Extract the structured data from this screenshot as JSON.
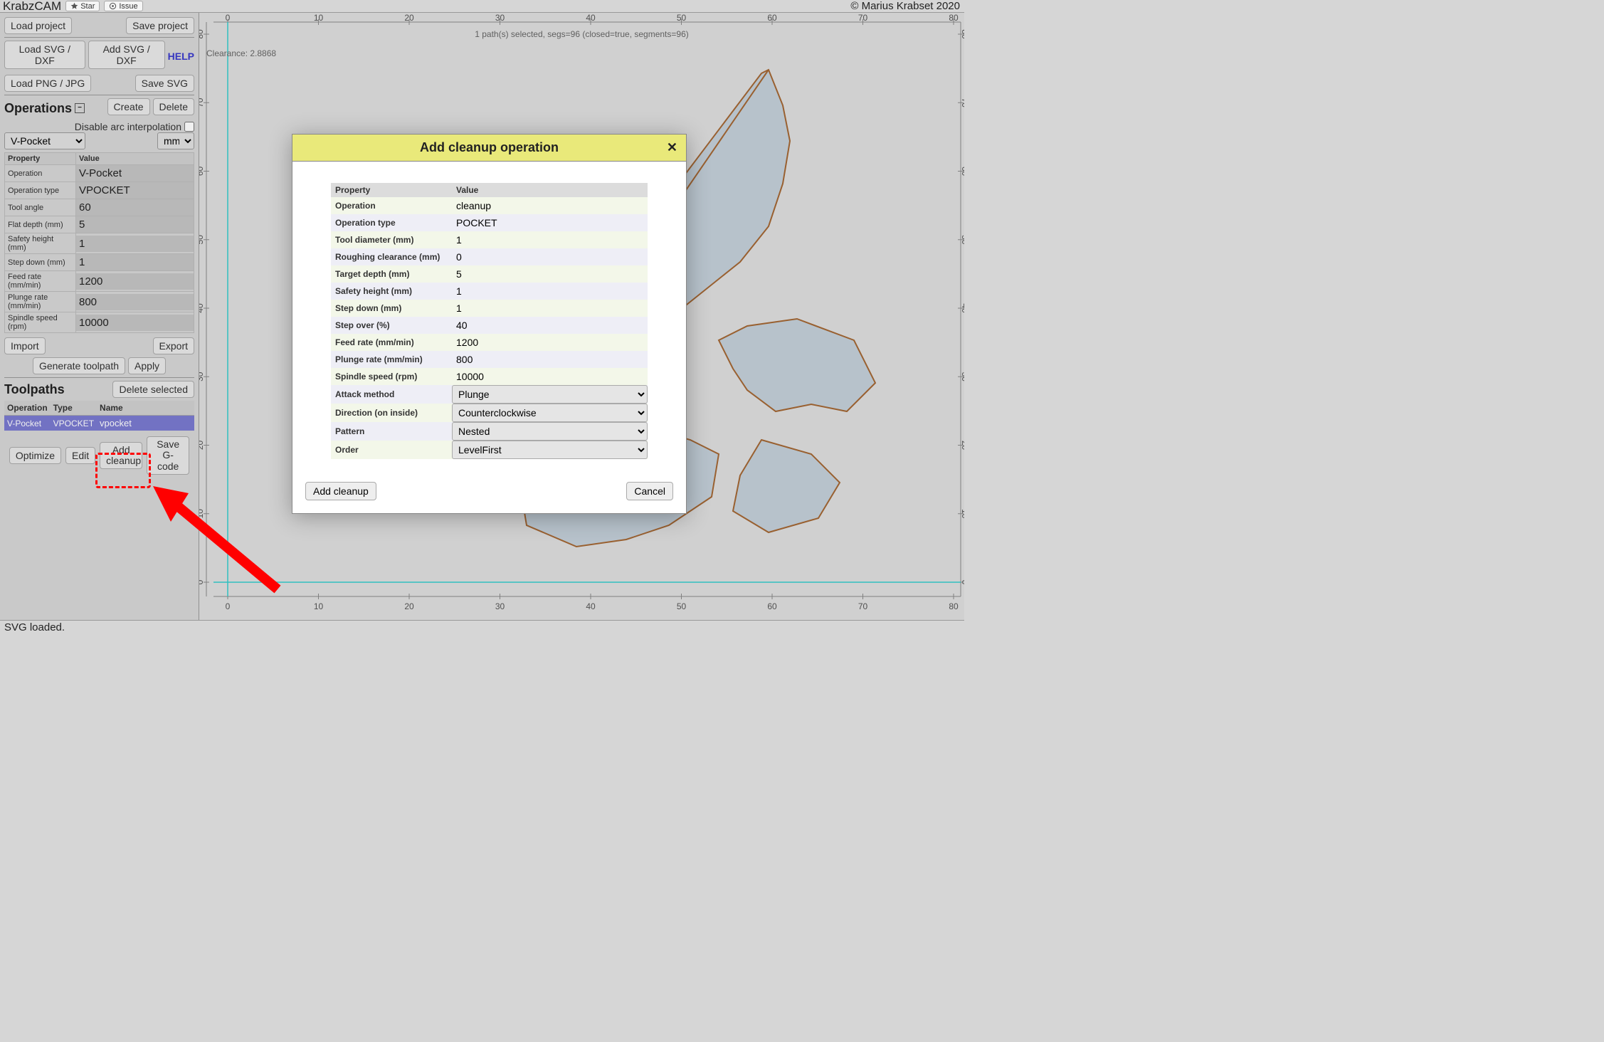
{
  "app": {
    "title": "KrabzCAM",
    "gh_star": "Star",
    "gh_issue": "Issue",
    "copyright": "© Marius Krabset 2020"
  },
  "sidebar": {
    "load_project": "Load project",
    "save_project": "Save project",
    "load_svg": "Load SVG / DXF",
    "add_svg": "Add SVG / DXF",
    "help": "HELP",
    "load_png": "Load PNG / JPG",
    "save_svg": "Save SVG",
    "operations_title": "Operations",
    "create": "Create",
    "delete": "Delete",
    "disable_arc": "Disable arc interpolation",
    "op_name_selected": "V-Pocket",
    "units_selected": "mm",
    "prop_header": "Property",
    "val_header": "Value",
    "props": [
      {
        "label": "Operation",
        "value": "V-Pocket"
      },
      {
        "label": "Operation type",
        "value": "VPOCKET"
      },
      {
        "label": "Tool angle",
        "value": "60"
      },
      {
        "label": "Flat depth (mm)",
        "value": "5"
      },
      {
        "label": "Safety height (mm)",
        "value": "1"
      },
      {
        "label": "Step down (mm)",
        "value": "1"
      },
      {
        "label": "Feed rate (mm/min)",
        "value": "1200"
      },
      {
        "label": "Plunge rate (mm/min)",
        "value": "800"
      },
      {
        "label": "Spindle speed (rpm)",
        "value": "10000"
      }
    ],
    "import": "Import",
    "export": "Export",
    "generate": "Generate toolpath",
    "apply": "Apply",
    "toolpaths_title": "Toolpaths",
    "delete_selected": "Delete selected",
    "tp_header_op": "Operation",
    "tp_header_type": "Type",
    "tp_header_name": "Name",
    "tp_row": {
      "op": "V-Pocket",
      "type": "VPOCKET",
      "name": "vpocket"
    },
    "optimize": "Optimize",
    "edit": "Edit",
    "add_cleanup": "Add cleanup",
    "save_gcode": "Save G-code"
  },
  "canvas": {
    "info": "1 path(s) selected, segs=96 (closed=true, segments=96)",
    "clearance": "Clearance: 2.8868",
    "axis_ticks": [
      "0",
      "10",
      "20",
      "30",
      "40",
      "50",
      "60",
      "70",
      "80"
    ]
  },
  "modal": {
    "title": "Add cleanup operation",
    "th_prop": "Property",
    "th_val": "Value",
    "rows": [
      {
        "label": "Operation",
        "type": "text",
        "value": "cleanup"
      },
      {
        "label": "Operation type",
        "type": "text",
        "value": "POCKET"
      },
      {
        "label": "Tool diameter (mm)",
        "type": "text",
        "value": "1"
      },
      {
        "label": "Roughing clearance (mm)",
        "type": "text",
        "value": "0"
      },
      {
        "label": "Target depth (mm)",
        "type": "text",
        "value": "5"
      },
      {
        "label": "Safety height (mm)",
        "type": "text",
        "value": "1"
      },
      {
        "label": "Step down (mm)",
        "type": "text",
        "value": "1"
      },
      {
        "label": "Step over (%)",
        "type": "text",
        "value": "40"
      },
      {
        "label": "Feed rate (mm/min)",
        "type": "text",
        "value": "1200"
      },
      {
        "label": "Plunge rate (mm/min)",
        "type": "text",
        "value": "800"
      },
      {
        "label": "Spindle speed (rpm)",
        "type": "text",
        "value": "10000"
      },
      {
        "label": "Attack method",
        "type": "select",
        "value": "Plunge"
      },
      {
        "label": "Direction (on inside)",
        "type": "select",
        "value": "Counterclockwise"
      },
      {
        "label": "Pattern",
        "type": "select",
        "value": "Nested"
      },
      {
        "label": "Order",
        "type": "select",
        "value": "LevelFirst"
      }
    ],
    "add_btn": "Add cleanup",
    "cancel_btn": "Cancel"
  },
  "status": "SVG loaded."
}
